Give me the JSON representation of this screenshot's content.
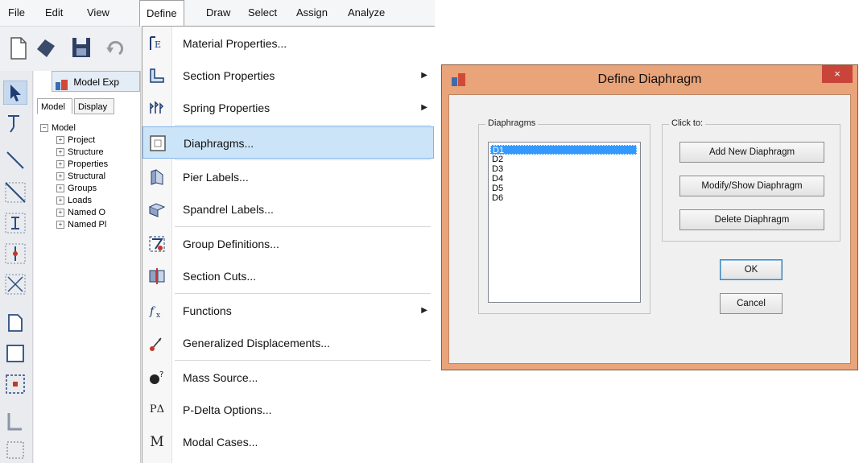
{
  "menubar": {
    "items": [
      "File",
      "Edit",
      "View",
      "Define",
      "Draw",
      "Select",
      "Assign",
      "Analyze"
    ],
    "active": "Define"
  },
  "explorer": {
    "title": "Model Exp",
    "tabs": [
      "Model",
      "Display"
    ],
    "tree": [
      {
        "label": "Model",
        "level": 0,
        "toggle": "−"
      },
      {
        "label": "Project",
        "level": 1,
        "toggle": "+"
      },
      {
        "label": "Structure",
        "level": 1,
        "toggle": "+"
      },
      {
        "label": "Properties",
        "level": 1,
        "toggle": "+"
      },
      {
        "label": "Structural",
        "level": 1,
        "toggle": "+"
      },
      {
        "label": "Groups",
        "level": 1,
        "toggle": "+"
      },
      {
        "label": "Loads",
        "level": 1,
        "toggle": "+"
      },
      {
        "label": "Named O",
        "level": 1,
        "toggle": "+"
      },
      {
        "label": "Named Pl",
        "level": 1,
        "toggle": "+"
      }
    ]
  },
  "define_menu": {
    "items": [
      {
        "label": "Material Properties...",
        "icon": "material-properties-icon",
        "submenu": false
      },
      {
        "label": "Section Properties",
        "icon": "section-properties-icon",
        "submenu": true
      },
      {
        "label": "Spring Properties",
        "icon": "spring-properties-icon",
        "submenu": true
      },
      {
        "label": "Diaphragms...",
        "icon": "diaphragm-icon",
        "submenu": false,
        "highlighted": true
      },
      {
        "label": "Pier Labels...",
        "icon": "pier-labels-icon",
        "submenu": false
      },
      {
        "label": "Spandrel Labels...",
        "icon": "spandrel-labels-icon",
        "submenu": false
      },
      {
        "label": "Group Definitions...",
        "icon": "group-definitions-icon",
        "submenu": false
      },
      {
        "label": "Section Cuts...",
        "icon": "section-cuts-icon",
        "submenu": false
      },
      {
        "label": "Functions",
        "icon": "functions-icon",
        "submenu": true
      },
      {
        "label": "Generalized Displacements...",
        "icon": "generalized-displacements-icon",
        "submenu": false
      },
      {
        "label": "Mass Source...",
        "icon": "mass-source-icon",
        "submenu": false
      },
      {
        "label": "P-Delta Options...",
        "icon": "p-delta-icon",
        "glyph": "PΔ",
        "submenu": false
      },
      {
        "label": "Modal Cases...",
        "icon": "modal-cases-icon",
        "glyph": "M",
        "submenu": false
      }
    ]
  },
  "dialog": {
    "title": "Define Diaphragm",
    "close_glyph": "×",
    "diaphragms_caption": "Diaphragms",
    "click_to_caption": "Click to:",
    "diaphragms": [
      "D1",
      "D2",
      "D3",
      "D4",
      "D5",
      "D6"
    ],
    "selected": "D1",
    "buttons": {
      "add": "Add New Diaphragm",
      "modify": "Modify/Show Diaphragm",
      "delete": "Delete Diaphragm",
      "ok": "OK",
      "cancel": "Cancel"
    }
  },
  "colors": {
    "dialog_frame": "#e9a47a",
    "menu_highlight": "#cce4f7",
    "list_selection": "#3399ff",
    "close_button": "#c9453a"
  }
}
